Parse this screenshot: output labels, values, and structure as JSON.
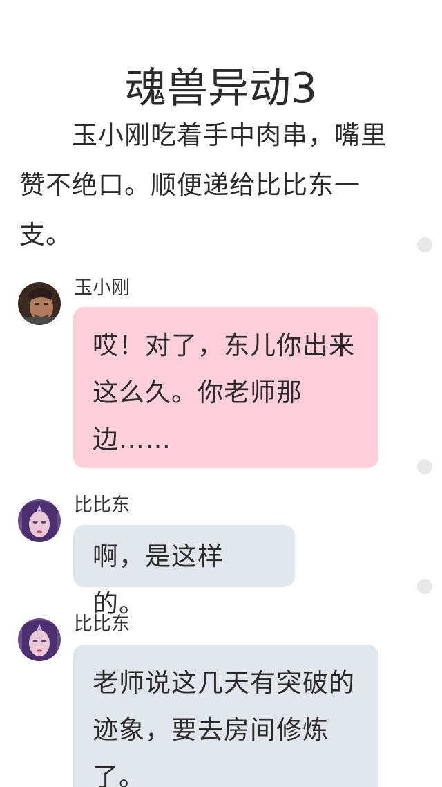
{
  "page": {
    "title": "魂兽异动3",
    "narration": "玉小刚吃着手中肉串，嘴里赞不绝口。顺便递给比比东一支。"
  },
  "messages": [
    {
      "sender": "玉小刚",
      "avatar_icon": "male-character-avatar",
      "bubble_color": "#ffd0d9",
      "text": "哎！对了，东儿你出来这么久。你老师那边……"
    },
    {
      "sender": "比比东",
      "avatar_icon": "female-character-avatar",
      "bubble_color": "#dfe6ee",
      "text": "啊，是这样的。"
    },
    {
      "sender": "比比东",
      "avatar_icon": "female-character-avatar",
      "bubble_color": "#dfe6ee",
      "text": "老师说这几天有突破的迹象，要去房间修炼了。"
    }
  ]
}
